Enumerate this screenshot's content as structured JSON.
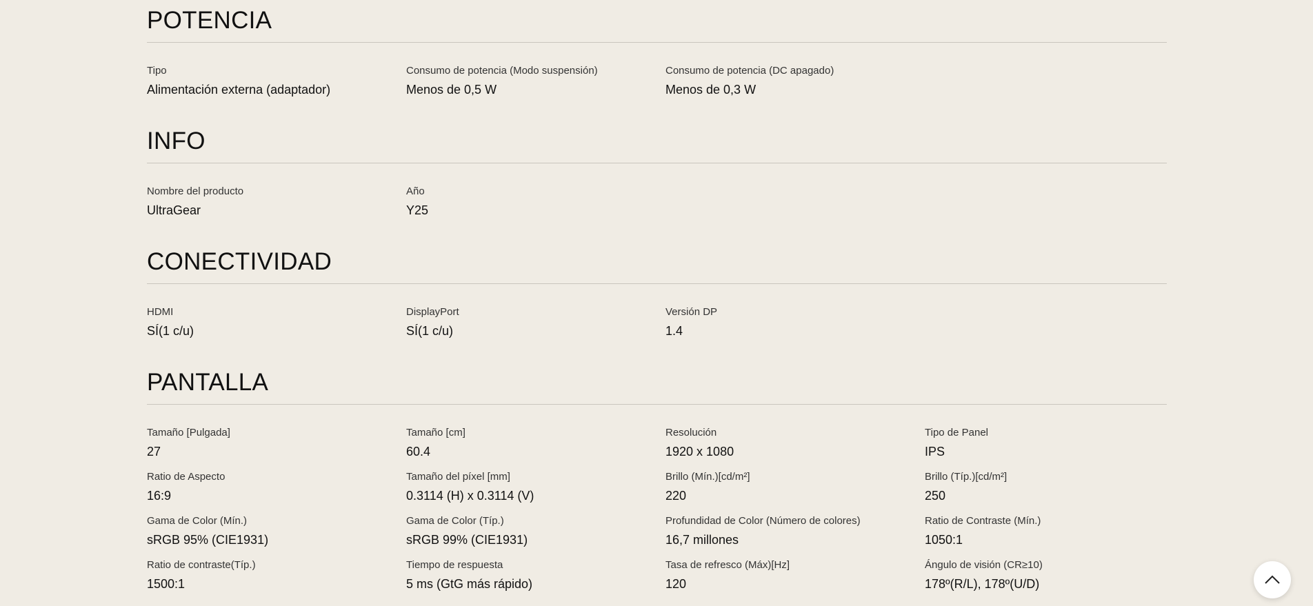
{
  "sections": [
    {
      "title": "POTENCIA",
      "specs": [
        {
          "label": "Tipo",
          "value": "Alimentación externa (adaptador)"
        },
        {
          "label": "Consumo de potencia (Modo suspensión)",
          "value": "Menos de 0,5 W"
        },
        {
          "label": "Consumo de potencia (DC apagado)",
          "value": "Menos de 0,3 W"
        }
      ]
    },
    {
      "title": "INFO",
      "specs": [
        {
          "label": "Nombre del producto",
          "value": "UltraGear"
        },
        {
          "label": "Año",
          "value": "Y25"
        }
      ]
    },
    {
      "title": "CONECTIVIDAD",
      "specs": [
        {
          "label": "HDMI",
          "value": "SÍ(1 c/u)"
        },
        {
          "label": "DisplayPort",
          "value": "SÍ(1 c/u)"
        },
        {
          "label": "Versión DP",
          "value": "1.4"
        }
      ]
    },
    {
      "title": "PANTALLA",
      "specs": [
        {
          "label": "Tamaño [Pulgada]",
          "value": "27"
        },
        {
          "label": "Tamaño [cm]",
          "value": "60.4"
        },
        {
          "label": "Resolución",
          "value": "1920 x 1080"
        },
        {
          "label": "Tipo de Panel",
          "value": "IPS"
        },
        {
          "label": "Ratio de Aspecto",
          "value": "16:9"
        },
        {
          "label": "Tamaño del píxel [mm]",
          "value": "0.3114 (H) x 0.3114 (V)"
        },
        {
          "label": "Brillo (Mín.)[cd/m²]",
          "value": "220"
        },
        {
          "label": "Brillo (Típ.)[cd/m²]",
          "value": "250"
        },
        {
          "label": "Gama de Color (Mín.)",
          "value": "sRGB 95% (CIE1931)"
        },
        {
          "label": "Gama de Color (Típ.)",
          "value": "sRGB 99% (CIE1931)"
        },
        {
          "label": "Profundidad de Color (Número de colores)",
          "value": "16,7 millones"
        },
        {
          "label": "Ratio de Contraste (Mín.)",
          "value": "1050:1"
        },
        {
          "label": "Ratio de contraste(Típ.)",
          "value": "1500:1"
        },
        {
          "label": "Tiempo de respuesta",
          "value": "5 ms (GtG más rápido)"
        },
        {
          "label": "Tasa de refresco (Máx)[Hz]",
          "value": "120"
        },
        {
          "label": "Ángulo de visión (CR≥10)",
          "value": "178º(R/L), 178º(U/D)"
        }
      ]
    }
  ],
  "scroll_top": {
    "icon": "chevron-up-icon"
  },
  "colors": {
    "background": "#f0ece4",
    "divider": "#c9c5bd",
    "text": "#111111"
  }
}
